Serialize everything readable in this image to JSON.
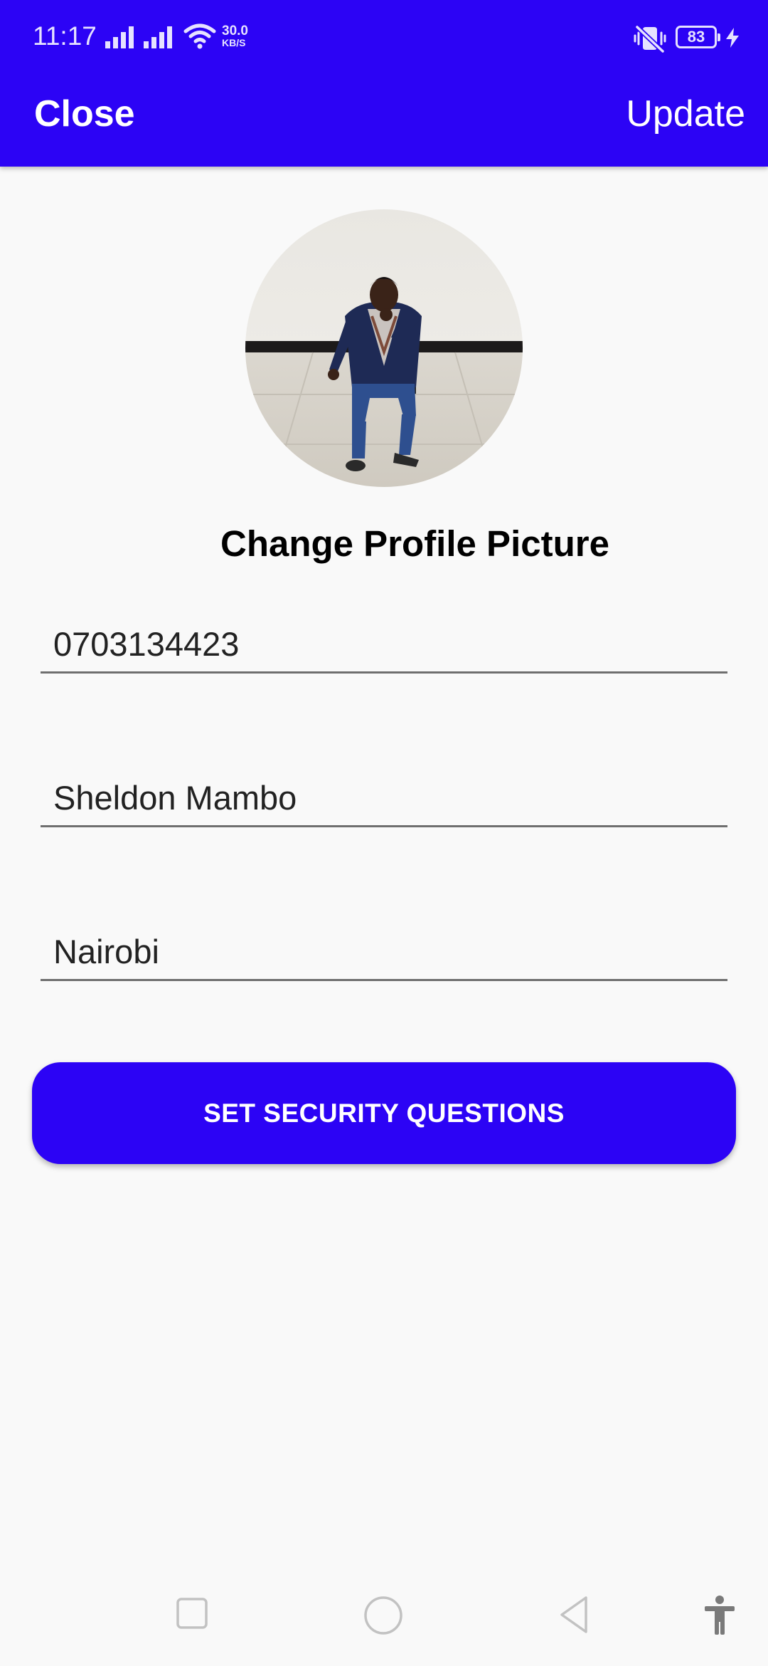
{
  "status_bar": {
    "time": "11:17",
    "net_speed_value": "30.0",
    "net_speed_unit": "KB/S",
    "battery_level": "83",
    "icons": [
      "signal-icon",
      "signal-icon",
      "wifi-icon",
      "vibrate-off-icon",
      "battery-icon",
      "charging-icon"
    ]
  },
  "app_bar": {
    "close_label": "Close",
    "update_label": "Update",
    "background_color": "#2c03f5"
  },
  "profile": {
    "change_picture_label": "Change Profile Picture"
  },
  "form": {
    "phone": "0703134423",
    "name": "Sheldon Mambo",
    "city": "Nairobi"
  },
  "actions": {
    "security_button_label": "SET SECURITY QUESTIONS",
    "accent_color": "#2c03f5"
  },
  "nav_bar": {
    "icons": [
      "recents-icon",
      "home-icon",
      "back-icon",
      "accessibility-icon"
    ]
  }
}
